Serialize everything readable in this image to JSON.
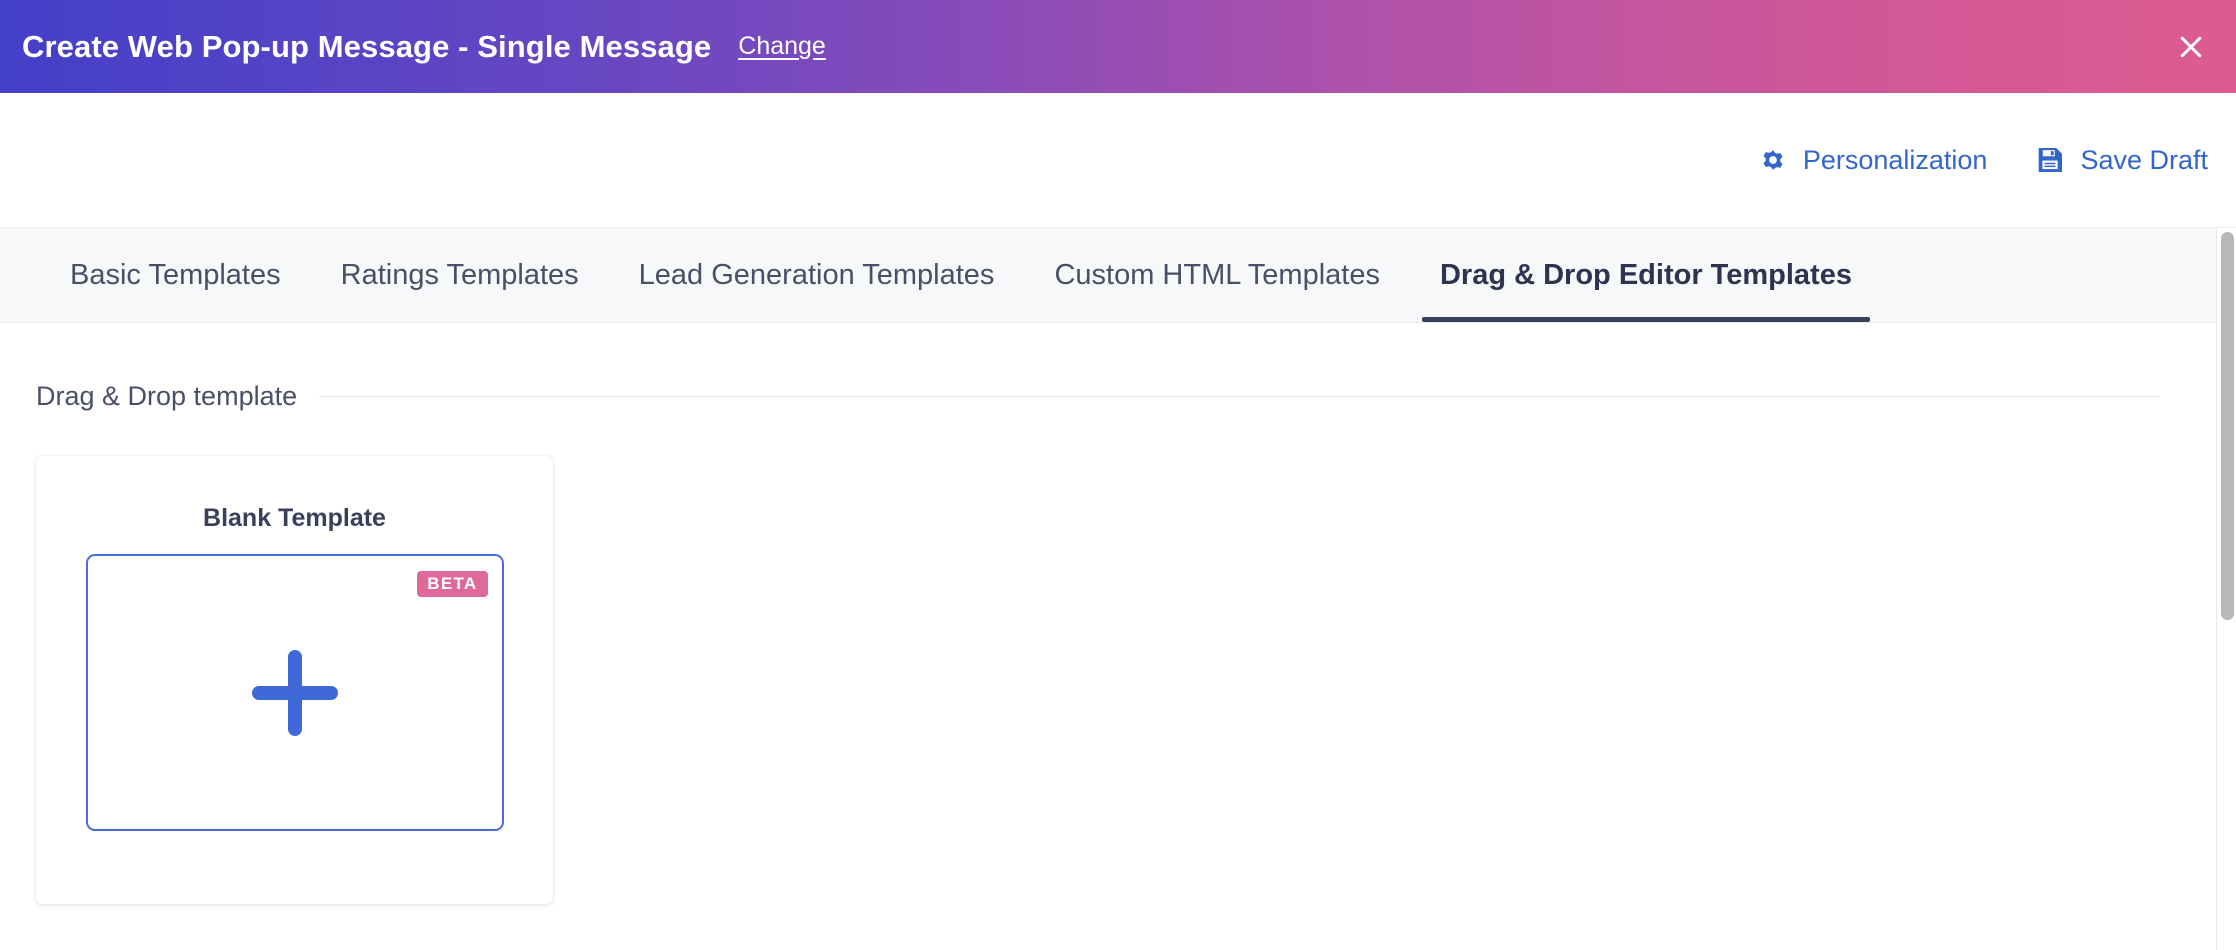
{
  "header": {
    "title": "Create Web Pop-up Message - Single Message",
    "change_link": "Change",
    "close_icon": "close-icon",
    "gradient_start": "#4340c8",
    "gradient_end": "#dd5b90"
  },
  "toolbar": {
    "actions": [
      {
        "label": "Personalization",
        "icon": "gear-icon"
      },
      {
        "label": "Save Draft",
        "icon": "save-disk-icon"
      }
    ],
    "link_color": "#3366cc"
  },
  "tabs": [
    {
      "label": "Basic Templates",
      "active": false
    },
    {
      "label": "Ratings Templates",
      "active": false
    },
    {
      "label": "Lead Generation Templates",
      "active": false
    },
    {
      "label": "Custom HTML Templates",
      "active": false
    },
    {
      "label": "Drag & Drop Editor Templates",
      "active": true
    }
  ],
  "section": {
    "title": "Drag & Drop template"
  },
  "templates": [
    {
      "name": "Blank Template",
      "badge": "BETA",
      "badge_color": "#e0699b",
      "accent_color": "#4069d8",
      "icon": "plus-icon"
    }
  ],
  "scrollbar": {
    "thumb_color": "#b6b8bb"
  }
}
